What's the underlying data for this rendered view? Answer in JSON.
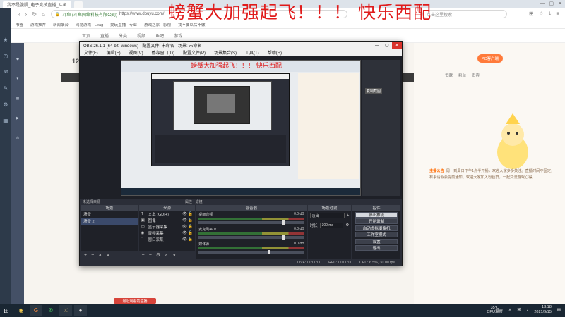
{
  "overlay_text": "螃蟹大加强起飞！！！ 快乐西配",
  "browser": {
    "tabs": [
      {
        "label": "我不是腹肌_电子竞技直播_斗鱼",
        "active": true
      },
      {
        "label": "",
        "active": false
      }
    ],
    "url_text": "斗鱼 (斗鱼网络科技有限公司)",
    "url": "https://www.douyu.com/",
    "search_placeholder": "点击这里搜索",
    "bookmarks": [
      "书签",
      "游戏推荐",
      "新闻聚合",
      "网易游戏 - Leag",
      "爱玩直播 - 专业",
      "游戏之家 - 影视",
      "我不要以后不做"
    ]
  },
  "douyu": {
    "nav": [
      "首页",
      "直播",
      "分类",
      "视频",
      "鱼吧",
      "游戏"
    ],
    "room_number": "12",
    "pc_button": "PC客户端",
    "side_tabs": [
      "贡献",
      "粉丝",
      "贵宾"
    ],
    "notice_title": "主播公告",
    "notice_body": "周一到周日下午1点半开播，欢迎大家多多关注。直播时间不固定，有事请假会提前通知。欢迎大家加入粉丝群，一起交流游戏心得。",
    "recent_chip": "最近观看的主播"
  },
  "obs": {
    "title": "OBS 26.1.1 (64-bit, windows) - 配置文件: 未命名 - 场景: 未命名",
    "menu": [
      "文件(F)",
      "编辑(E)",
      "视图(V)",
      "停靠窗口(D)",
      "配置文件(P)",
      "场景集合(S)",
      "工具(T)",
      "帮助(H)"
    ],
    "preview_chip": "复制截图",
    "status_mid": {
      "left": "未选择来源",
      "right": "属性 · 滤镜"
    },
    "docks": {
      "scenes": {
        "title": "场景",
        "items": [
          {
            "label": "场景",
            "selected": false
          },
          {
            "label": "场景 2",
            "selected": true
          }
        ]
      },
      "sources": {
        "title": "来源",
        "items": [
          {
            "icon": "T",
            "label": "文本 (GDI+)"
          },
          {
            "icon": "▣",
            "label": "图像"
          },
          {
            "icon": "▭",
            "label": "显示器采集"
          },
          {
            "icon": "◉",
            "label": "音频采集"
          },
          {
            "icon": "□",
            "label": "窗口采集"
          }
        ]
      },
      "mixer": {
        "title": "混音器",
        "tracks": [
          {
            "name": "桌面音频",
            "db": "0.0 dB"
          },
          {
            "name": "麦克风/Aux",
            "db": "0.0 dB"
          },
          {
            "name": "媒体源",
            "db": "0.0 dB"
          }
        ]
      },
      "transitions": {
        "title": "场景过渡",
        "type": "淡出",
        "duration_label": "时长",
        "duration": "300 ms"
      },
      "controls": {
        "title": "控件",
        "buttons": [
          {
            "label": "停止推流",
            "active": true
          },
          {
            "label": "开始录制",
            "active": false
          },
          {
            "label": "启动虚拟摄像机",
            "active": false
          },
          {
            "label": "工作室模式",
            "active": false
          },
          {
            "label": "设置",
            "active": false
          },
          {
            "label": "退出",
            "active": false
          }
        ]
      }
    },
    "status": {
      "live": "LIVE: 00:00:00",
      "rec": "REC: 00:00:00",
      "cpu": "CPU: 6.5%, 30.00 fps"
    }
  },
  "taskbar": {
    "weather": {
      "temp": "35°C",
      "label": "CPU温度"
    },
    "clock": {
      "time": "13:18",
      "date": "2021/9/15"
    }
  }
}
